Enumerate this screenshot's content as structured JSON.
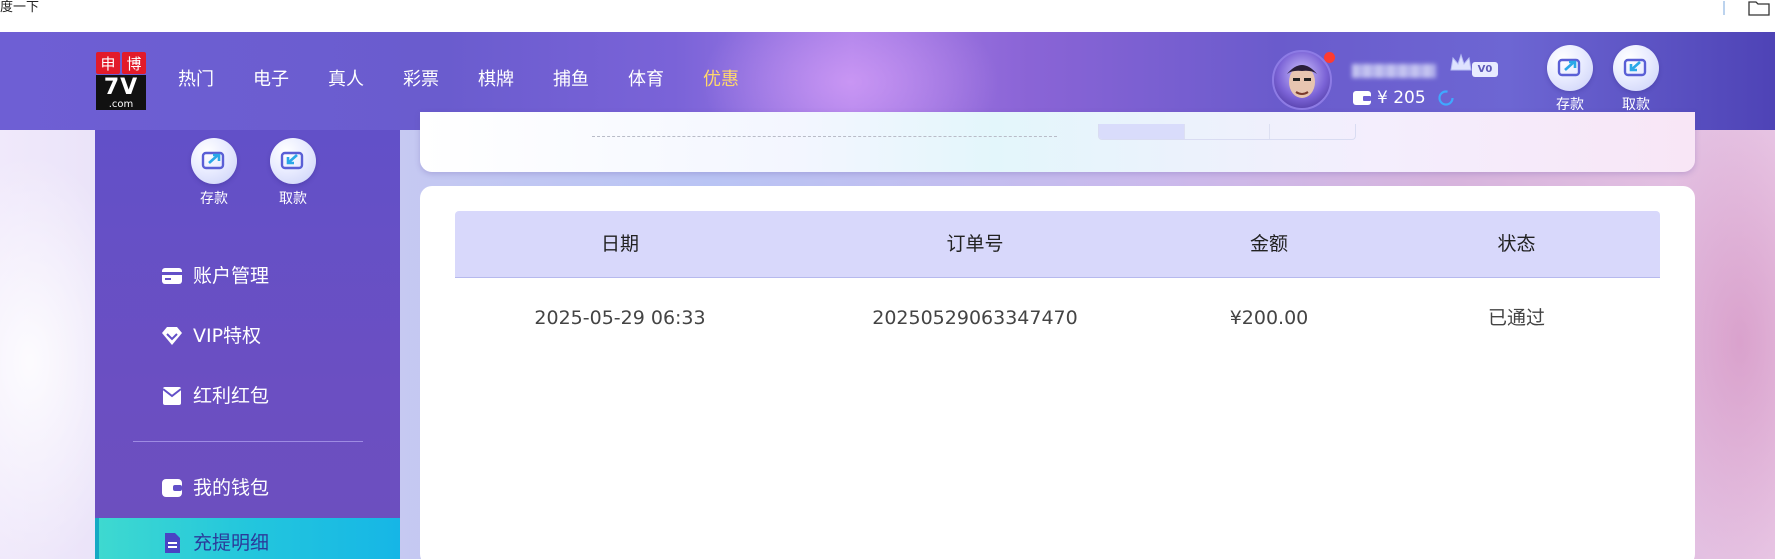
{
  "browser": {
    "crumb_text": "度一下"
  },
  "header": {
    "logo": {
      "char1": "申",
      "char2": "博",
      "brand": "7V",
      "domain": ".com"
    },
    "nav": [
      "热门",
      "电子",
      "真人",
      "彩票",
      "棋牌",
      "捕鱼",
      "体育",
      "优惠"
    ],
    "user": {
      "vip_level": "V0",
      "balance": "¥ 205"
    },
    "deposit_label": "存款",
    "withdraw_label": "取款"
  },
  "sidebar": {
    "deposit_label": "存款",
    "withdraw_label": "取款",
    "menu": [
      {
        "label": "账户管理",
        "icon": "card-icon"
      },
      {
        "label": "VIP特权",
        "icon": "diamond-icon"
      },
      {
        "label": "红利红包",
        "icon": "envelope-icon"
      },
      {
        "label": "我的钱包",
        "icon": "wallet-icon"
      },
      {
        "label": "充提明细",
        "icon": "document-icon",
        "active": true
      }
    ]
  },
  "table": {
    "headers": [
      "日期",
      "订单号",
      "金额",
      "状态"
    ],
    "rows": [
      [
        "2025-05-29 06:33",
        "20250529063347470",
        "¥200.00",
        "已通过"
      ]
    ]
  },
  "colors": {
    "header_purple": "#6e5fd4",
    "promo_yellow": "#ffd86b",
    "active_teal": "#23c6dd",
    "table_header": "#d8d8fb"
  }
}
